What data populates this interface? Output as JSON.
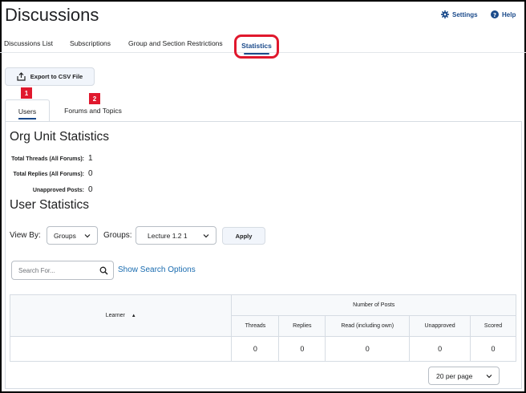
{
  "page": {
    "title": "Discussions"
  },
  "header": {
    "settings_label": "Settings",
    "help_label": "Help"
  },
  "nav": {
    "items": [
      "Discussions List",
      "Subscriptions",
      "Group and Section Restrictions"
    ],
    "active": "Statistics"
  },
  "toolbar": {
    "export_label": "Export to CSV File"
  },
  "annotations": {
    "badge1": "1",
    "badge2": "2",
    "color": "#e0182d"
  },
  "tabs": {
    "users": "Users",
    "forums": "Forums and Topics"
  },
  "org_stats": {
    "title": "Org Unit Statistics",
    "rows": [
      {
        "label": "Total Threads (All Forums):",
        "value": "1"
      },
      {
        "label": "Total Replies (All Forums):",
        "value": "0"
      },
      {
        "label": "Unapproved Posts:",
        "value": "0"
      }
    ]
  },
  "user_stats": {
    "title": "User Statistics",
    "view_by_label": "View By:",
    "view_by_value": "Groups",
    "groups_label": "Groups:",
    "groups_value": "Lecture 1.2 1",
    "apply_label": "Apply"
  },
  "search": {
    "placeholder": "Search For...",
    "options_link": "Show Search Options"
  },
  "table": {
    "learner_header": "Learner",
    "group_header": "Number of Posts",
    "columns": [
      "Threads",
      "Replies",
      "Read (including own)",
      "Unapproved",
      "Scored"
    ],
    "row": [
      "0",
      "0",
      "0",
      "0",
      "0"
    ]
  },
  "pagination": {
    "per_page": "20 per page"
  },
  "colors": {
    "link": "#1a6cb0",
    "accent": "#1a4a8a",
    "border": "#d6dce3"
  }
}
